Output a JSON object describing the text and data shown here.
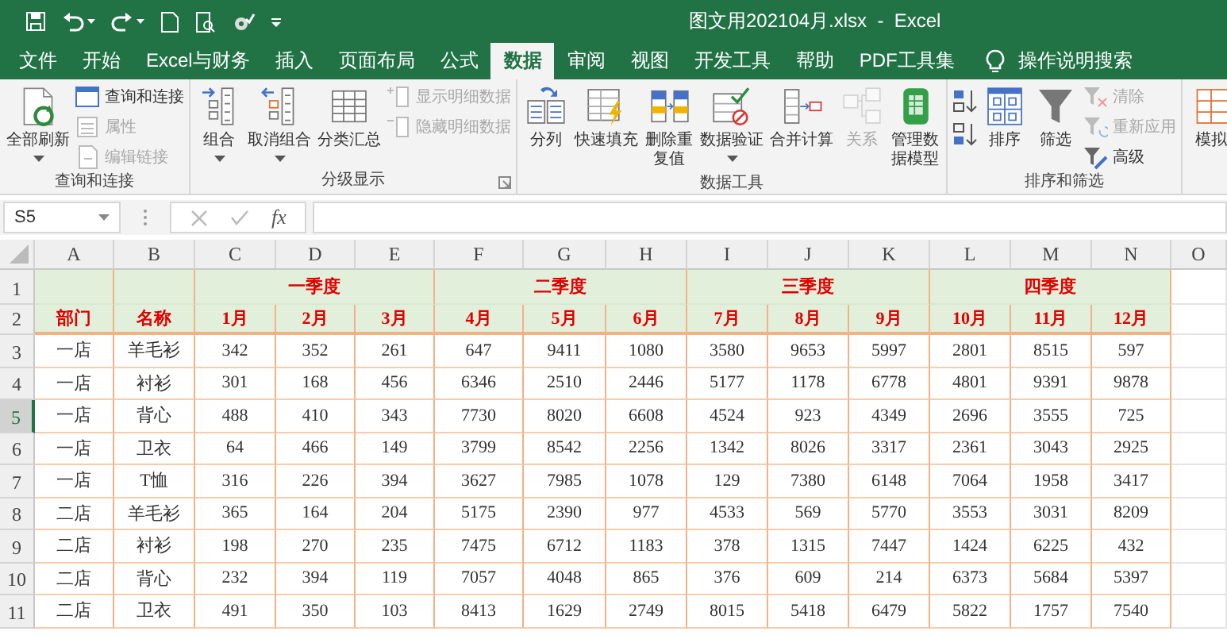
{
  "title_bar": {
    "title": "图文用202104月.xlsx  -  Excel"
  },
  "tabs": [
    {
      "label": "文件",
      "selected": false
    },
    {
      "label": "开始",
      "selected": false
    },
    {
      "label": "Excel与财务",
      "selected": false
    },
    {
      "label": "插入",
      "selected": false
    },
    {
      "label": "页面布局",
      "selected": false
    },
    {
      "label": "公式",
      "selected": false
    },
    {
      "label": "数据",
      "selected": true
    },
    {
      "label": "审阅",
      "selected": false
    },
    {
      "label": "视图",
      "selected": false
    },
    {
      "label": "开发工具",
      "selected": false
    },
    {
      "label": "帮助",
      "selected": false
    },
    {
      "label": "PDF工具集",
      "selected": false
    }
  ],
  "tell_me": {
    "label": "操作说明搜索"
  },
  "ribbon": {
    "groups": [
      {
        "name": "查询和连接",
        "launcher": false,
        "items": [
          {
            "kind": "large",
            "label": "全部刷新",
            "dropdown": true,
            "disabled": false
          },
          {
            "kind": "stack",
            "items": [
              {
                "label": "查询和连接",
                "disabled": false
              },
              {
                "label": "属性",
                "disabled": true
              },
              {
                "label": "编辑链接",
                "disabled": true
              }
            ]
          }
        ]
      },
      {
        "name": "分级显示",
        "launcher": true,
        "items": [
          {
            "kind": "large",
            "label": "组合",
            "dropdown": true,
            "disabled": false
          },
          {
            "kind": "large",
            "label": "取消组合",
            "dropdown": true,
            "disabled": false
          },
          {
            "kind": "large",
            "label": "分类汇总",
            "dropdown": false,
            "disabled": false
          },
          {
            "kind": "stack",
            "items": [
              {
                "label": "显示明细数据",
                "disabled": true
              },
              {
                "label": "隐藏明细数据",
                "disabled": true
              }
            ]
          }
        ]
      },
      {
        "name": "数据工具",
        "launcher": false,
        "items": [
          {
            "kind": "large",
            "label": "分列",
            "dropdown": false,
            "disabled": false
          },
          {
            "kind": "large",
            "label": "快速填充",
            "dropdown": false,
            "disabled": false
          },
          {
            "kind": "large",
            "label": "删除重复值",
            "dropdown": false,
            "disabled": false
          },
          {
            "kind": "large",
            "label": "数据验证",
            "dropdown": true,
            "disabled": false
          },
          {
            "kind": "large",
            "label": "合并计算",
            "dropdown": false,
            "disabled": false
          },
          {
            "kind": "large",
            "label": "关系",
            "dropdown": false,
            "disabled": true
          },
          {
            "kind": "large",
            "label": "管理数据模型",
            "dropdown": false,
            "disabled": false
          }
        ]
      },
      {
        "name": "排序和筛选",
        "launcher": false,
        "items": [
          {
            "kind": "sort_pair"
          },
          {
            "kind": "large",
            "label": "排序",
            "dropdown": false,
            "disabled": false
          },
          {
            "kind": "large",
            "label": "筛选",
            "dropdown": false,
            "disabled": false
          },
          {
            "kind": "stack",
            "items": [
              {
                "label": "清除",
                "disabled": true
              },
              {
                "label": "重新应用",
                "disabled": true
              },
              {
                "label": "高级",
                "disabled": false
              }
            ]
          }
        ]
      },
      {
        "items": [
          {
            "kind": "large",
            "label": "模拟",
            "dropdown": false,
            "disabled": false
          }
        ]
      }
    ]
  },
  "formula_bar": {
    "name_box": "S5",
    "function_label": "fx"
  },
  "sheet": {
    "columns": [
      "A",
      "B",
      "C",
      "D",
      "E",
      "F",
      "G",
      "H",
      "I",
      "J",
      "K",
      "L",
      "M",
      "N",
      "O"
    ],
    "quarter_row": {
      "number": "1",
      "selected": false,
      "quarters": [
        "一季度",
        "二季度",
        "三季度",
        "四季度"
      ]
    },
    "header_row": {
      "number": "2",
      "selected": false,
      "cells": [
        "部门",
        "名称",
        "1月",
        "2月",
        "3月",
        "4月",
        "5月",
        "6月",
        "7月",
        "8月",
        "9月",
        "10月",
        "11月",
        "12月"
      ]
    },
    "rows": [
      {
        "number": "3",
        "selected": false,
        "cells": [
          "一店",
          "羊毛衫",
          "342",
          "352",
          "261",
          "647",
          "9411",
          "1080",
          "3580",
          "9653",
          "5997",
          "2801",
          "8515",
          "597"
        ]
      },
      {
        "number": "4",
        "selected": false,
        "cells": [
          "一店",
          "衬衫",
          "301",
          "168",
          "456",
          "6346",
          "2510",
          "2446",
          "5177",
          "1178",
          "6778",
          "4801",
          "9391",
          "9878"
        ]
      },
      {
        "number": "5",
        "selected": true,
        "cells": [
          "一店",
          "背心",
          "488",
          "410",
          "343",
          "7730",
          "8020",
          "6608",
          "4524",
          "923",
          "4349",
          "2696",
          "3555",
          "725"
        ]
      },
      {
        "number": "6",
        "selected": false,
        "cells": [
          "一店",
          "卫衣",
          "64",
          "466",
          "149",
          "3799",
          "8542",
          "2256",
          "1342",
          "8026",
          "3317",
          "2361",
          "3043",
          "2925"
        ]
      },
      {
        "number": "7",
        "selected": false,
        "cells": [
          "一店",
          "T恤",
          "316",
          "226",
          "394",
          "3627",
          "7985",
          "1078",
          "129",
          "7380",
          "6148",
          "7064",
          "1958",
          "3417"
        ]
      },
      {
        "number": "8",
        "selected": false,
        "cells": [
          "二店",
          "羊毛衫",
          "365",
          "164",
          "204",
          "5175",
          "2390",
          "977",
          "4533",
          "569",
          "5770",
          "3553",
          "3031",
          "8209"
        ]
      },
      {
        "number": "9",
        "selected": false,
        "cells": [
          "二店",
          "衬衫",
          "198",
          "270",
          "235",
          "7475",
          "6712",
          "1183",
          "378",
          "1315",
          "7447",
          "1424",
          "6225",
          "432"
        ]
      },
      {
        "number": "10",
        "selected": false,
        "cells": [
          "二店",
          "背心",
          "232",
          "394",
          "119",
          "7057",
          "4048",
          "865",
          "376",
          "609",
          "214",
          "6373",
          "5684",
          "5397"
        ]
      },
      {
        "number": "11",
        "selected": false,
        "cells": [
          "二店",
          "卫衣",
          "491",
          "350",
          "103",
          "8413",
          "1629",
          "2749",
          "8015",
          "5418",
          "6479",
          "5822",
          "1757",
          "7540"
        ]
      }
    ]
  }
}
